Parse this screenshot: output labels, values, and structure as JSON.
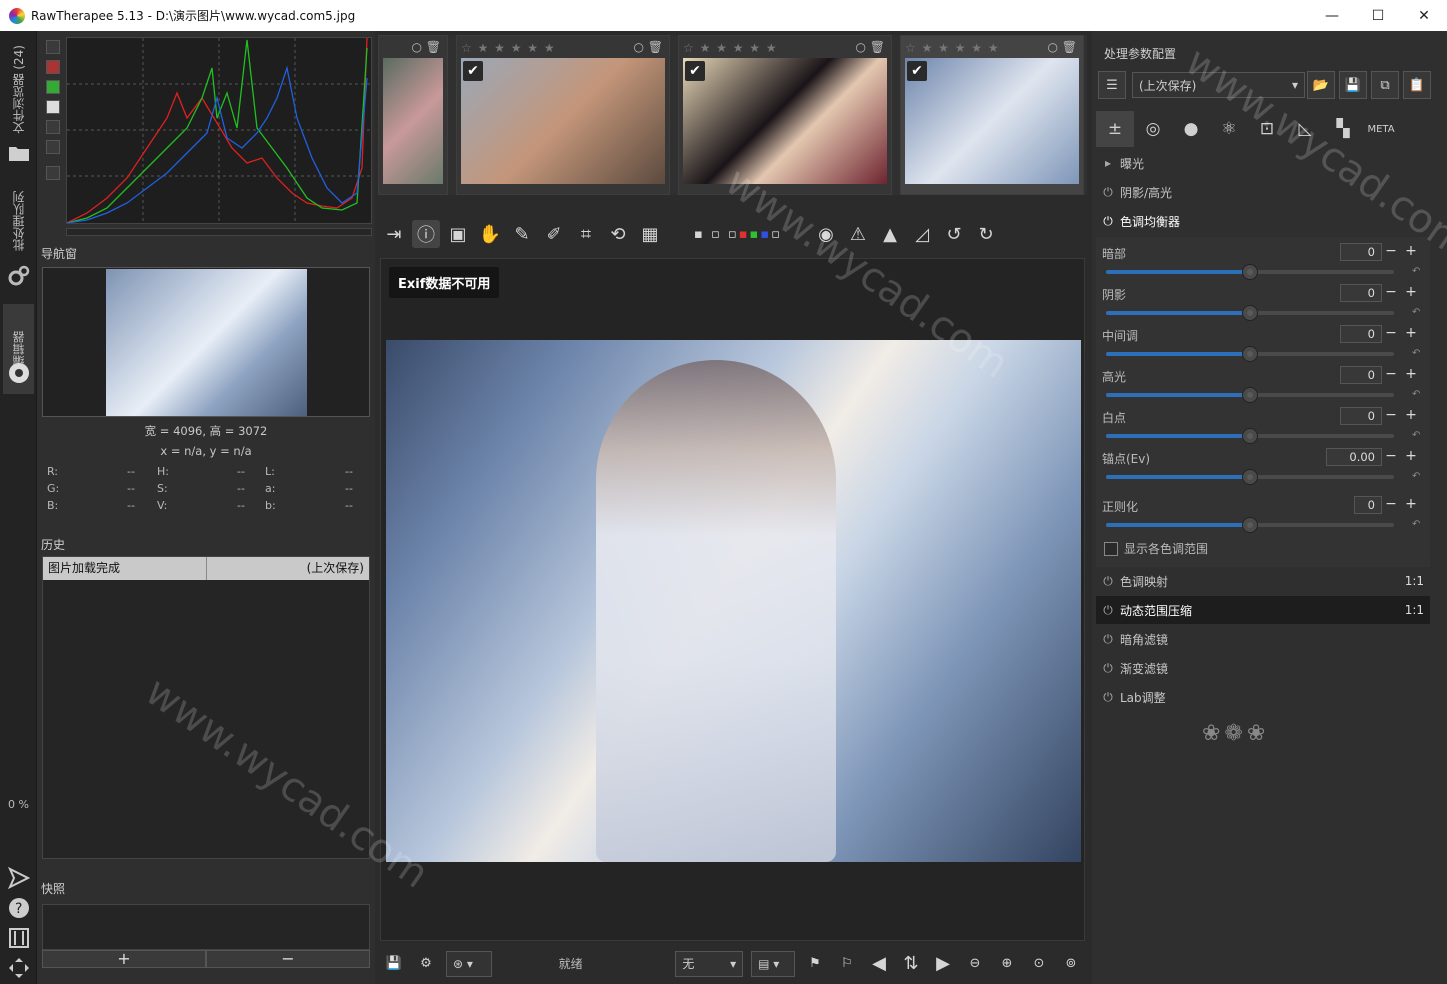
{
  "window": {
    "title": "RawTherapee 5.13 - D:\\演示图片\\www.wycad.com5.jpg",
    "minimize_icon": "minimize-icon",
    "maximize_icon": "maximize-icon",
    "close_icon": "close-icon"
  },
  "left_rail": {
    "file_browser_tab": "文件浏览器 (24)",
    "batch_queue_tab": "批处理队列",
    "editor_tab": "编辑器",
    "progress": "0 %"
  },
  "histogram": {
    "colors": {
      "red": "#e02020",
      "green": "#20c020",
      "blue": "#2060e0"
    }
  },
  "navigator": {
    "title": "导航窗",
    "size_line": "宽 = 4096, 高 = 3072",
    "coord_line": "x = n/a, y = n/a",
    "channels": [
      {
        "label": "R:",
        "value": "--"
      },
      {
        "label": "H:",
        "value": "--"
      },
      {
        "label": "L:",
        "value": "--"
      },
      {
        "label": "G:",
        "value": "--"
      },
      {
        "label": "S:",
        "value": "--"
      },
      {
        "label": "a:",
        "value": "--"
      },
      {
        "label": "B:",
        "value": "--"
      },
      {
        "label": "V:",
        "value": "--"
      },
      {
        "label": "b:",
        "value": "--"
      }
    ]
  },
  "history": {
    "title": "历史",
    "rows": [
      {
        "action": "图片加载完成",
        "value": "(上次保存)"
      }
    ]
  },
  "snapshots": {
    "title": "快照",
    "add": "+",
    "remove": "−"
  },
  "filmstrip": {
    "items": [
      {
        "stars": "",
        "checked": false,
        "color": "#7a5a5a"
      },
      {
        "stars": "☆ ★ ★ ★ ★ ★",
        "checked": true,
        "color": "#8a7a6a"
      },
      {
        "stars": "☆ ★ ★ ★ ★ ★",
        "checked": true,
        "color": "#b39373"
      },
      {
        "stars": "☆ ★ ★ ★ ★ ★",
        "checked": true,
        "color": "#8ea3c1"
      }
    ]
  },
  "preview": {
    "exif_badge": "Exif数据不可用"
  },
  "statusbar": {
    "status": "就绪",
    "zoom_combo": "无"
  },
  "right_panel": {
    "profile_title": "处理参数配置",
    "profile_value": "(上次保存)",
    "tools": {
      "exposure": "曝光",
      "shadows_highlights": "阴影/高光",
      "tone_equalizer": "色调均衡器"
    },
    "sliders": [
      {
        "label": "暗部",
        "value": "0",
        "fraction": 0.5
      },
      {
        "label": "阴影",
        "value": "0",
        "fraction": 0.5
      },
      {
        "label": "中间调",
        "value": "0",
        "fraction": 0.5
      },
      {
        "label": "高光",
        "value": "0",
        "fraction": 0.5
      },
      {
        "label": "白点",
        "value": "0",
        "fraction": 0.5
      },
      {
        "label": "锚点(Ev)",
        "value": "0.00",
        "fraction": 0.5
      },
      {
        "label": "正则化",
        "value": "0",
        "fraction": 0.5
      }
    ],
    "show_ranges_label": "显示各色调范围",
    "collapsed_tools": [
      {
        "label": "色调映射",
        "ratio": "1:1",
        "active": false
      },
      {
        "label": "动态范围压缩",
        "ratio": "1:1",
        "active": true
      },
      {
        "label": "暗角滤镜",
        "ratio": "",
        "active": false
      },
      {
        "label": "渐变滤镜",
        "ratio": "",
        "active": false
      },
      {
        "label": "Lab调整",
        "ratio": "",
        "active": false
      }
    ]
  }
}
